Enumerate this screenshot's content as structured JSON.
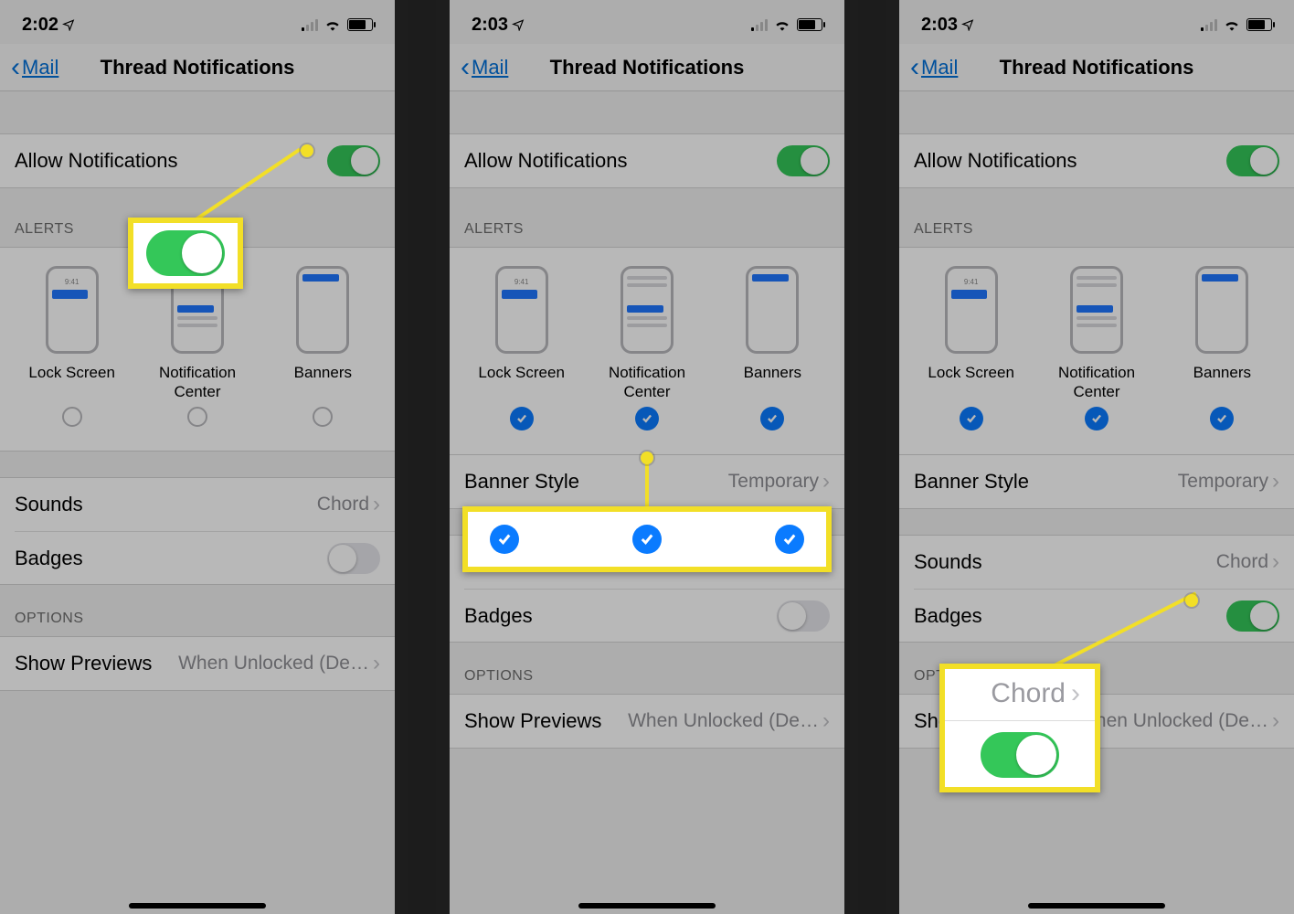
{
  "status": {
    "time_a": "2:02",
    "time_b": "2:03",
    "time_c": "2:03"
  },
  "nav": {
    "back_label": "Mail",
    "title": "Thread Notifications"
  },
  "allow": {
    "label": "Allow Notifications"
  },
  "alerts": {
    "header": "ALERTS",
    "lock": "Lock Screen",
    "nc": "Notification Center",
    "banners": "Banners",
    "sample_time": "9:41"
  },
  "banner_style": {
    "label": "Banner Style",
    "value": "Temporary"
  },
  "sounds": {
    "label": "Sounds",
    "value": "Chord"
  },
  "badges": {
    "label": "Badges"
  },
  "options": {
    "header": "OPTIONS"
  },
  "previews": {
    "label": "Show Previews",
    "value": "When Unlocked (De…"
  },
  "callout3": {
    "sound_value": "Chord"
  }
}
